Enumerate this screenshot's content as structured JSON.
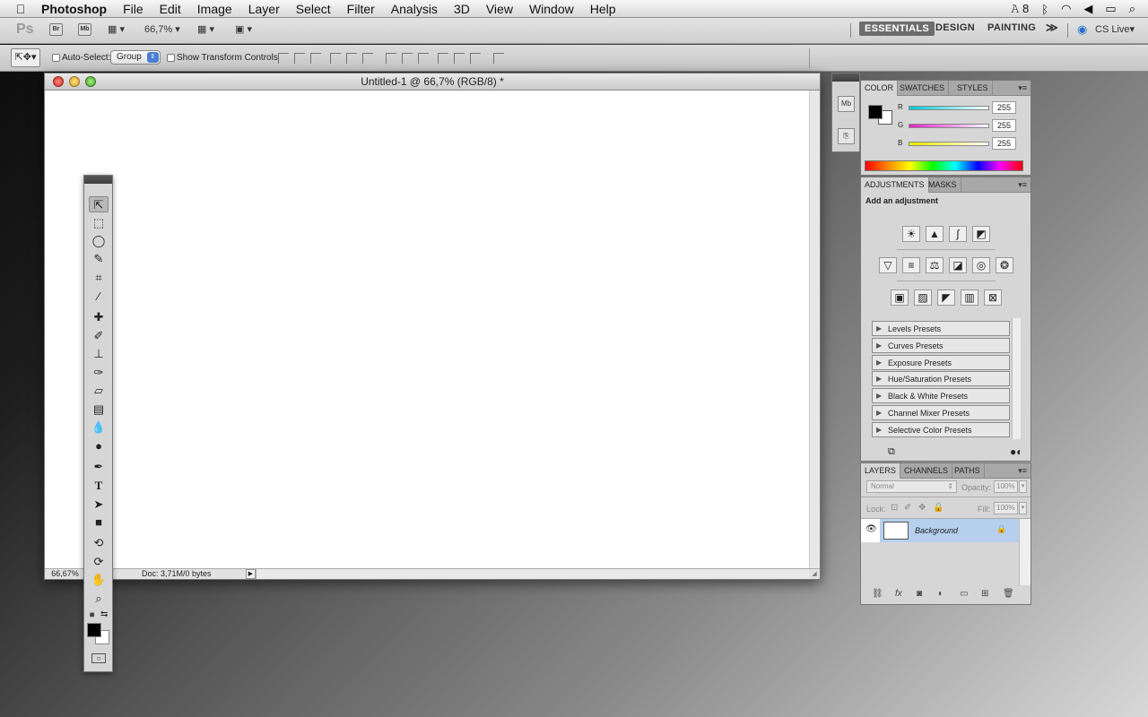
{
  "menubar": {
    "apple": "",
    "app_name": "Photoshop",
    "items": [
      "File",
      "Edit",
      "Image",
      "Layer",
      "Select",
      "Filter",
      "Analysis",
      "3D",
      "View",
      "Window",
      "Help"
    ],
    "status_icons": {
      "adobe": "𝙰 8",
      "bluetooth": "ᛒ",
      "wifi": "◠",
      "volume": "◀",
      "battery": "▭",
      "spotlight": "⌕"
    }
  },
  "appbar": {
    "ps_logo": "Ps",
    "bridge_label": "Br",
    "minibridge_label": "Mb",
    "zoom_value": "66,7%",
    "workspaces": [
      "ESSENTIALS",
      "DESIGN",
      "PAINTING"
    ],
    "more": "≫",
    "cs_live": "CS Live"
  },
  "options": {
    "auto_select_label": "Auto-Select:",
    "group_value": "Group",
    "transform_label": "Show Transform Controls"
  },
  "document": {
    "title": "Untitled-1 @ 66,7% (RGB/8) *",
    "zoom": "66,67%",
    "doc_info": "Doc: 3,71M/0 bytes"
  },
  "color_panel": {
    "tabs": [
      "COLOR",
      "SWATCHES",
      "STYLES"
    ],
    "channels": [
      {
        "label": "R",
        "value": "255",
        "color": "#00c8d8"
      },
      {
        "label": "G",
        "value": "255",
        "color": "#e020c8"
      },
      {
        "label": "B",
        "value": "255",
        "color": "#e8e800"
      }
    ]
  },
  "adjustments_panel": {
    "tabs": [
      "ADJUSTMENTS",
      "MASKS"
    ],
    "heading": "Add an adjustment",
    "presets": [
      "Levels Presets",
      "Curves Presets",
      "Exposure Presets",
      "Hue/Saturation Presets",
      "Black & White Presets",
      "Channel Mixer Presets",
      "Selective Color Presets"
    ]
  },
  "layers_panel": {
    "tabs": [
      "LAYERS",
      "CHANNELS",
      "PATHS"
    ],
    "blend_mode": "Normal",
    "opacity_label": "Opacity:",
    "opacity_value": "100%",
    "lock_label": "Lock:",
    "fill_label": "Fill:",
    "fill_value": "100%",
    "layer_name": "Background"
  },
  "colors": {
    "accent": "#4a7fd6",
    "layer_selected": "#b6cfee"
  }
}
